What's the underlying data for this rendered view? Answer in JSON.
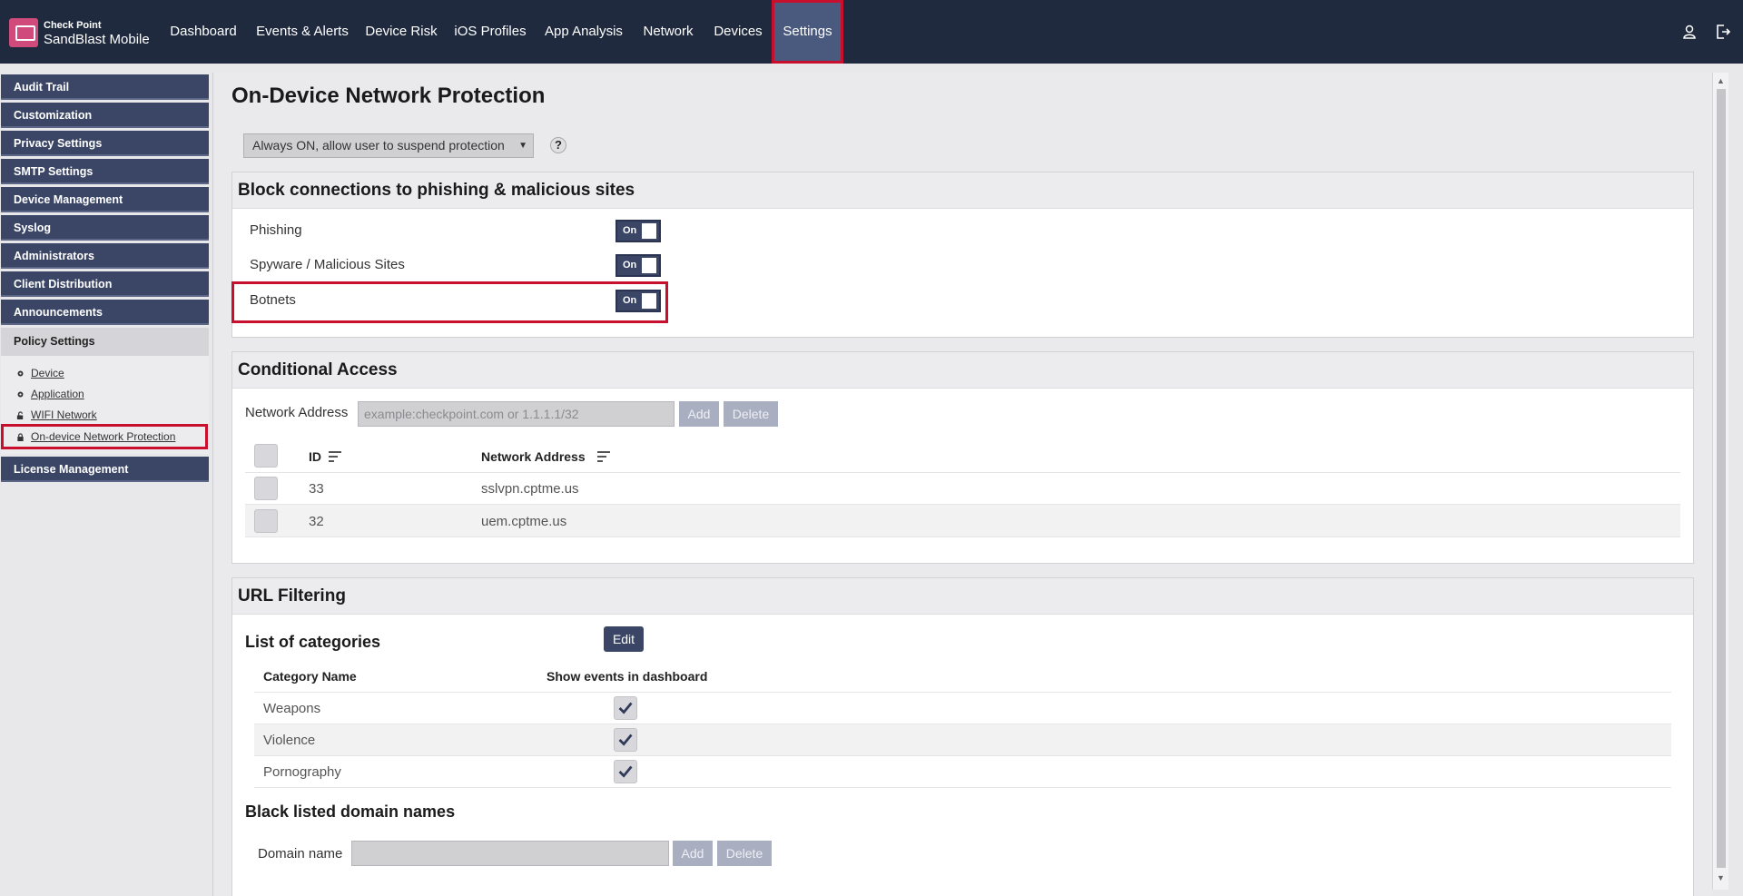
{
  "header": {
    "brand_small": "Check Point",
    "brand_large": "SandBlast Mobile",
    "nav": [
      "Dashboard",
      "Events & Alerts",
      "Device Risk",
      "iOS Profiles",
      "App Analysis",
      "Network",
      "Devices",
      "Settings"
    ],
    "active_nav": "Settings",
    "icons": [
      "user-icon",
      "logout-icon"
    ]
  },
  "sidebar": {
    "items": [
      "Audit Trail",
      "Customization",
      "Privacy Settings",
      "SMTP Settings",
      "Device Management",
      "Syslog",
      "Administrators",
      "Client Distribution",
      "Announcements",
      "Policy Settings",
      "License Management"
    ],
    "sub_items": [
      "Device",
      "Application",
      "WIFI Network",
      "On-device Network Protection"
    ],
    "selected_sub": "On-device Network Protection"
  },
  "page": {
    "title": "On-Device Network Protection",
    "mode": "Always ON, allow user to suspend protection",
    "help": "?"
  },
  "block": {
    "title": "Block connections to phishing & malicious sites",
    "rows": [
      {
        "label": "Phishing",
        "state": "On"
      },
      {
        "label": "Spyware / Malicious Sites",
        "state": "On"
      },
      {
        "label": "Botnets",
        "state": "On"
      }
    ]
  },
  "conditional": {
    "title": "Conditional Access",
    "field_label": "Network Address",
    "placeholder": "example:checkpoint.com or 1.1.1.1/32",
    "add": "Add",
    "delete": "Delete",
    "columns": [
      "ID",
      "Network Address"
    ],
    "rows": [
      {
        "id": "33",
        "address": "sslvpn.cptme.us"
      },
      {
        "id": "32",
        "address": "uem.cptme.us"
      }
    ]
  },
  "url": {
    "title": "URL Filtering",
    "categories_title": "List of categories",
    "edit": "Edit",
    "columns": [
      "Category Name",
      "Show events in dashboard"
    ],
    "rows": [
      {
        "name": "Weapons",
        "checked": true
      },
      {
        "name": "Violence",
        "checked": true
      },
      {
        "name": "Pornography",
        "checked": true
      }
    ],
    "blacklist_title": "Black listed domain names",
    "domain_label": "Domain name",
    "add": "Add",
    "delete": "Delete"
  },
  "colors": {
    "topbar": "#1f2a3e",
    "accent": "#3b4666",
    "highlight": "#c8102e"
  }
}
